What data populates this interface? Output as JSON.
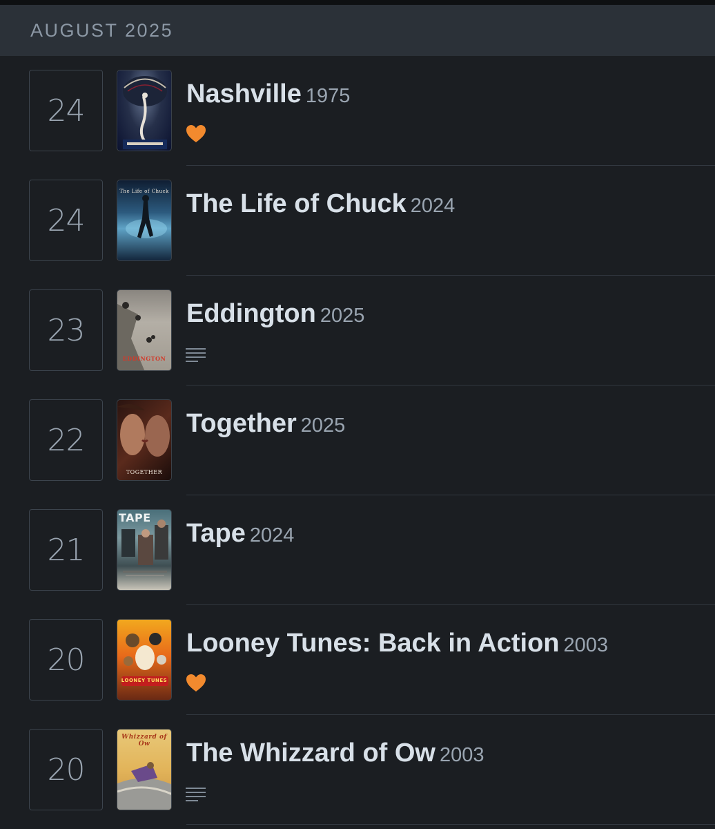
{
  "header": {
    "month": "AUGUST 2025"
  },
  "entries": [
    {
      "day": "24",
      "title": "Nashville",
      "year": "1975",
      "liked": true,
      "review": false,
      "poster_text": ""
    },
    {
      "day": "24",
      "title": "The Life of Chuck",
      "year": "2024",
      "liked": false,
      "review": false,
      "poster_text": "The Life of Chuck"
    },
    {
      "day": "23",
      "title": "Eddington",
      "year": "2025",
      "liked": false,
      "review": true,
      "poster_text": "EDDINGTON"
    },
    {
      "day": "22",
      "title": "Together",
      "year": "2025",
      "liked": false,
      "review": false,
      "poster_text": "TOGETHER"
    },
    {
      "day": "21",
      "title": "Tape",
      "year": "2024",
      "liked": false,
      "review": false,
      "poster_text": "TAPE"
    },
    {
      "day": "20",
      "title": "Looney Tunes: Back in Action",
      "year": "2003",
      "liked": true,
      "review": false,
      "poster_text": "LOONEY TUNES"
    },
    {
      "day": "20",
      "title": "The Whizzard of Ow",
      "year": "2003",
      "liked": false,
      "review": true,
      "poster_text": "Whizzard of Ow"
    }
  ],
  "colors": {
    "background": "#1b1e22",
    "header_bg": "#2b3138",
    "heart": "#f28a2e",
    "title": "#d8e0e8",
    "muted": "#9aa5b1"
  },
  "icons": {
    "like": "heart-icon",
    "review": "review-lines-icon"
  }
}
